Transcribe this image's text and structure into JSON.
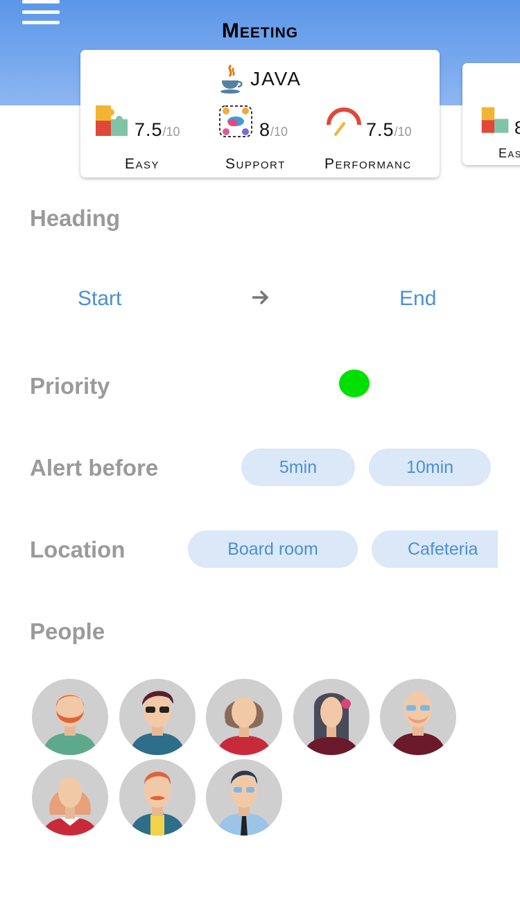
{
  "header": {
    "title": "Meeting"
  },
  "card": {
    "language": "JAVA",
    "metrics": [
      {
        "value": "7.5",
        "max": "/10",
        "label": "Easy"
      },
      {
        "value": "8",
        "max": "/10",
        "label": "Support"
      },
      {
        "value": "7.5",
        "max": "/10",
        "label": "Performanc"
      }
    ]
  },
  "peek_card": {
    "value": "8",
    "label": "Eas"
  },
  "form": {
    "heading_label": "Heading",
    "start_label": "Start",
    "end_label": "End",
    "priority_label": "Priority",
    "priority_color": "#00e000",
    "alert_label": "Alert before",
    "alert_options": [
      "5min",
      "10min"
    ],
    "location_label": "Location",
    "location_options": [
      "Board room",
      "Cafeteria"
    ],
    "people_label": "People"
  },
  "colors": {
    "accent": "#4a8fd6",
    "pill_bg": "#dbe8f8",
    "header_top": "#5b96e8",
    "header_bottom": "#8db6f2"
  }
}
